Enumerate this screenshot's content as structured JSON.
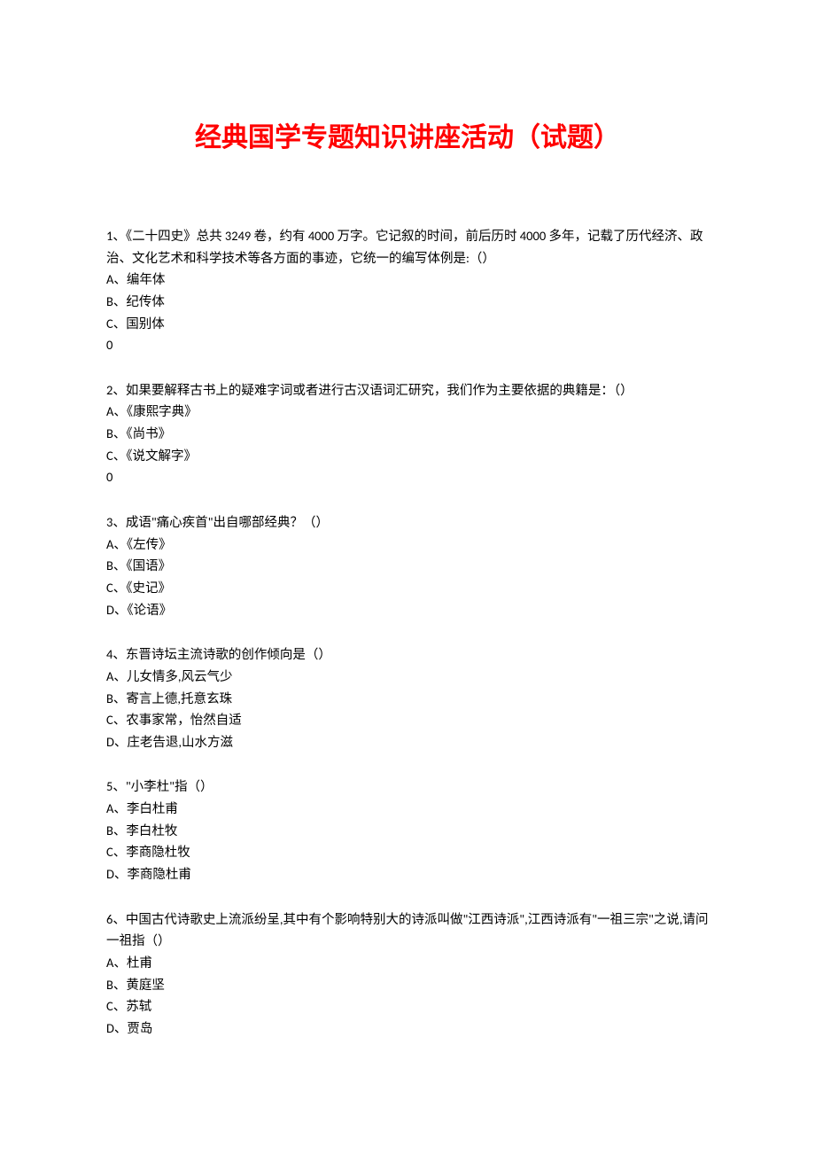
{
  "title": "经典国学专题知识讲座活动（试题）",
  "questions": [
    {
      "prompt": "1、《二十四史》总共 3249 卷，约有 4000 万字。它记叙的时间，前后历时 4000 多年，记载了历代经济、政治、文化艺术和科学技术等各方面的事迹，它统一的编写体例是:（）",
      "choices": [
        "A、编年体",
        "B、纪传体",
        "C、国别体"
      ],
      "trailing": "0"
    },
    {
      "prompt": "2、如果要解释古书上的疑难字词或者进行古汉语词汇研究，我们作为主要依据的典籍是：（）",
      "choices": [
        "A、《康熙字典》",
        "B、《尚书》",
        "C、《说文解字》"
      ],
      "trailing": "0"
    },
    {
      "prompt": "3、成语\"痛心疾首\"出自哪部经典？（）",
      "choices": [
        "A、《左传》",
        "B、《国语》",
        "C、《史记》",
        "D、《论语》"
      ]
    },
    {
      "prompt": "4、东晋诗坛主流诗歌的创作倾向是（）",
      "choices": [
        "A、儿女情多,风云气少",
        "B、寄言上德,托意玄珠",
        "C、农事家常，怡然自适",
        "D、庄老告退,山水方滋"
      ]
    },
    {
      "prompt": "5、\"小李杜\"指（）",
      "choices": [
        "A、李白杜甫",
        "B、李白杜牧",
        "C、李商隐杜牧",
        "D、李商隐杜甫"
      ]
    },
    {
      "prompt": "6、中国古代诗歌史上流派纷呈,其中有个影响特别大的诗派叫做\"江西诗派\",江西诗派有\"一祖三宗\"之说,请问一祖指（）",
      "choices": [
        "A、杜甫",
        "B、黄庭坚",
        "C、苏轼",
        "D、贾岛"
      ]
    }
  ]
}
